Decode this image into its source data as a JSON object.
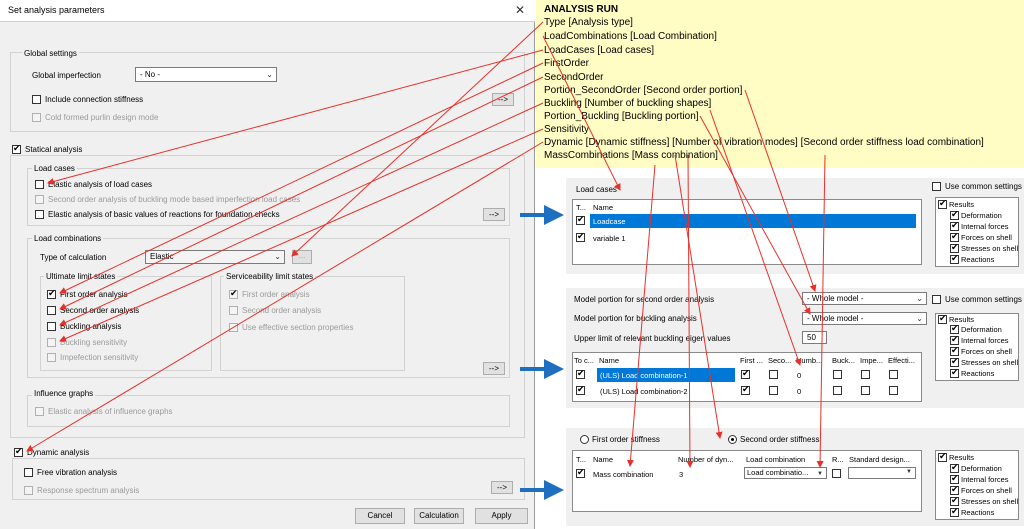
{
  "dialog": {
    "title": "Set analysis parameters",
    "close_glyph": "✕",
    "global_settings": {
      "header": "Global settings",
      "imperfection_label": "Global imperfection",
      "imperfection_value": "- No -",
      "include_connection_stiffness": "Include connection stiffness",
      "cold_formed": "Cold formed purlin design mode",
      "more_button": "-->"
    },
    "statical": {
      "label": "Statical analysis",
      "load_cases": {
        "header": "Load cases",
        "elastic": "Elastic analysis of load cases",
        "second_order_buckling": "Second order analysis of buckling mode based imperfection load cases",
        "reactions": "Elastic analysis of basic values of reactions for foundation checks",
        "more_button": "-->"
      },
      "load_combinations": {
        "header": "Load combinations",
        "type_label": "Type of calculation",
        "type_value": "Elastic",
        "dots": "...",
        "uls_header": "Ultimate limit states",
        "first_order": "First order analysis",
        "second_order": "Second order analysis",
        "buckling": "Buckling analysis",
        "buckling_sensitivity": "Buckling sensitivity",
        "imperfection_sensitivity": "Impefection sensitivity",
        "sls_header": "Serviceability limit states",
        "sls_first_order": "First order analysis",
        "sls_second_order": "Second order analysis",
        "sls_effective": "Use effective section properties",
        "more_button": "-->"
      },
      "influence": {
        "header": "Influence graphs",
        "elastic": "Elastic analysis of influence graphs"
      }
    },
    "dynamic": {
      "label": "Dynamic analysis",
      "free_vibration": "Free vibration analysis",
      "response_spectrum": "Response spectrum analysis",
      "more_button": "-->"
    },
    "buttons": {
      "cancel": "Cancel",
      "calculation": "Calculation",
      "apply": "Apply"
    }
  },
  "annotation": {
    "title": "ANALYSIS RUN",
    "lines": [
      "Type [Analysis type]",
      "LoadCombinations [Load Combination]",
      "LoadCases [Load cases]",
      "FirstOrder",
      "SecondOrder",
      "Portion_SecondOrder [Second order portion]",
      "Buckling [Number of buckling shapes]",
      "Portion_Buckling [Buckling portion]",
      "Sensitivity",
      "Dynamic [Dynamic stiffness] [Number of vibration modes] [Second order stiffness load combination]",
      "MassCombinations [Mass combination]"
    ],
    "arrow_color": "#e8302a",
    "blue_arrow_color": "#1f6fc0"
  },
  "panel1": {
    "header": "Load cases",
    "use_common": "Use common settings",
    "col_t": "T...",
    "col_name": "Name",
    "rows": [
      "Loadcase",
      "variable 1"
    ],
    "results": {
      "root": "Results",
      "items": [
        "Deformation",
        "Internal forces",
        "Forces on shell",
        "Stresses on shell",
        "Reactions"
      ]
    }
  },
  "panel2": {
    "model_portion_second": "Model portion for second order analysis",
    "model_portion_second_value": "- Whole model -",
    "model_portion_buckling": "Model portion for buckling analysis",
    "model_portion_buckling_value": "- Whole model -",
    "upper_limit": "Upper limit of relevant buckling eigen values",
    "upper_limit_value": "50",
    "use_common": "Use common settings",
    "cols": [
      "To c...",
      "Name",
      "First ...",
      "Seco...",
      "Numb...",
      "Buck...",
      "Impe...",
      "Effecti..."
    ],
    "rows": [
      {
        "name": "(ULS) Load combination-1",
        "numb": "0"
      },
      {
        "name": "(ULS) Load combination-2",
        "numb": "0"
      }
    ],
    "results": {
      "root": "Results",
      "items": [
        "Deformation",
        "Internal forces",
        "Forces on shell",
        "Stresses on shell",
        "Reactions"
      ]
    }
  },
  "panel3": {
    "first_order_stiffness": "First order stiffness",
    "second_order_stiffness": "Second order stiffness",
    "cols": [
      "T...",
      "Name",
      "Number of dyn...",
      "Load combination",
      "R...",
      "Standard design..."
    ],
    "row": {
      "name": "Mass combination",
      "number": "3",
      "load_combination": "Load combinatio..."
    },
    "results": {
      "root": "Results",
      "items": [
        "Deformation",
        "Internal forces",
        "Forces on shell",
        "Stresses on shell",
        "Reactions"
      ]
    }
  }
}
